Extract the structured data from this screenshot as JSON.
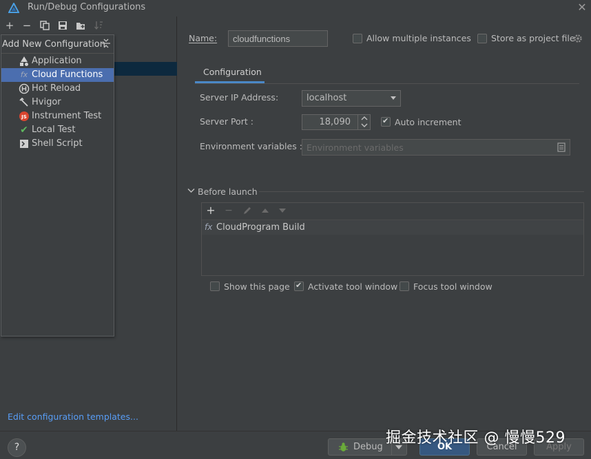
{
  "window": {
    "title": "Run/Debug Configurations"
  },
  "popup": {
    "title": "Add New Configuration",
    "items": [
      {
        "label": "Application",
        "icon": "application-icon"
      },
      {
        "label": "Cloud Functions",
        "icon": "fx-icon",
        "selected": true
      },
      {
        "label": "Hot Reload",
        "icon": "hot-reload-icon"
      },
      {
        "label": "Hvigor",
        "icon": "hvigor-icon"
      },
      {
        "label": "Instrument Test",
        "icon": "js-icon"
      },
      {
        "label": "Local Test",
        "icon": "check-icon"
      },
      {
        "label": "Shell Script",
        "icon": "shell-script-icon"
      }
    ]
  },
  "left": {
    "edit_templates": "Edit configuration templates..."
  },
  "form": {
    "name_label": "Name:",
    "name_value": "cloudfunctions",
    "allow_multiple": "Allow multiple instances",
    "store_as_project": "Store as project file",
    "tab": "Configuration",
    "server_ip_label": "Server IP Address:",
    "server_ip_value": "localhost",
    "server_port_label": "Server Port :",
    "server_port_value": "18,090",
    "auto_increment": "Auto increment",
    "env_label": "Environment variables :",
    "env_placeholder": "Environment variables"
  },
  "before_launch": {
    "title": "Before launch",
    "task_icon": "fx",
    "task": "CloudProgram Build",
    "show_this_page": "Show this page",
    "activate_tool_window": "Activate tool window",
    "focus_tool_window": "Focus tool window"
  },
  "buttons": {
    "help": "?",
    "debug": "Debug",
    "ok": "OK",
    "cancel": "Cancel",
    "apply": "Apply"
  },
  "watermark": "掘金技术社区 @ 慢慢529",
  "colors": {
    "selection": "#4b6eaf",
    "link": "#589df6",
    "accent": "#4a88c7",
    "ok_button": "#365880"
  }
}
